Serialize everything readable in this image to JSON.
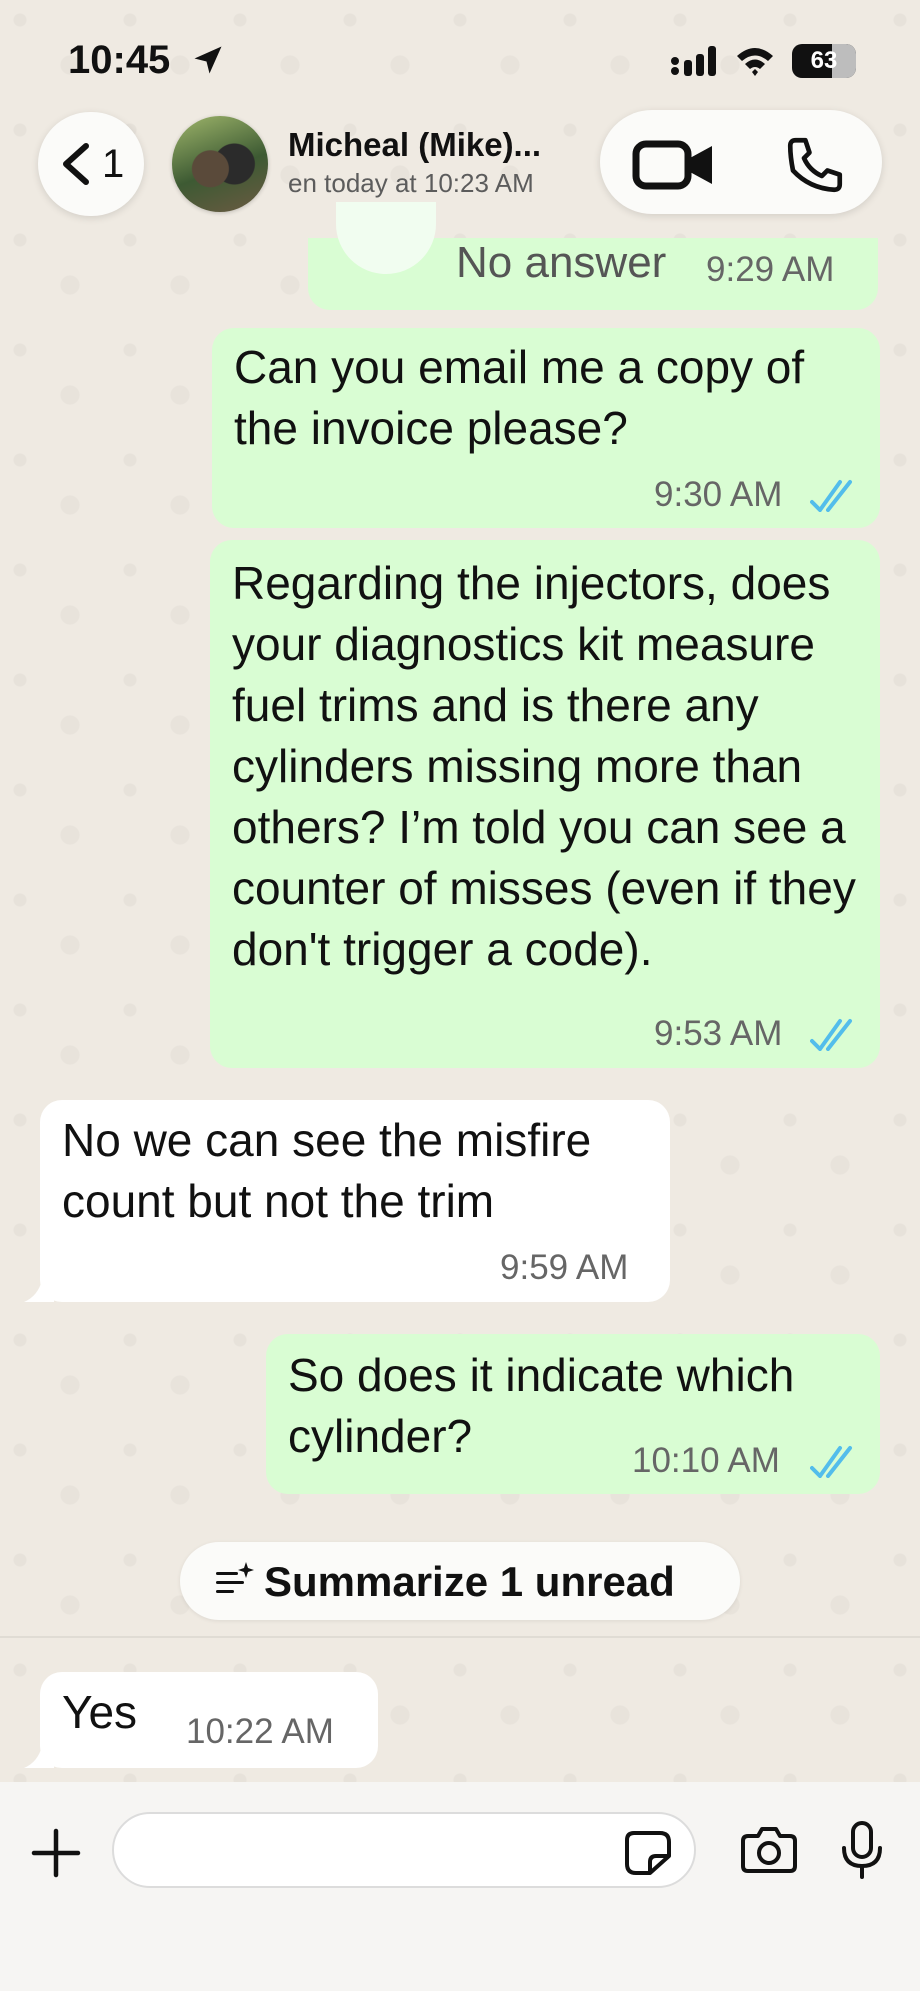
{
  "status_bar": {
    "time": "10:45",
    "battery_percent": "63",
    "battery_level": 0.63
  },
  "header": {
    "back_count": "1",
    "contact_name": "Micheal (Mike)...",
    "last_seen": "en today at 10:23 AM"
  },
  "messages": [
    {
      "direction": "outgoing",
      "text": "No answer",
      "time": "9:29 AM",
      "kind": "call"
    },
    {
      "direction": "outgoing",
      "text": "Can you email me a copy of the invoice please?",
      "time": "9:30 AM",
      "read": true
    },
    {
      "direction": "outgoing",
      "text": "Regarding the injectors, does your diagnostics kit measure fuel trims and is there any cylinders missing more than others? I’m told you can see a counter of misses (even if they don't trigger a code).",
      "time": "9:53 AM",
      "read": true
    },
    {
      "direction": "incoming",
      "text": "No we can see the misfire count but not the trim",
      "time": "9:59 AM"
    },
    {
      "direction": "outgoing",
      "text": "So does it indicate which cylinder?",
      "time": "10:10 AM",
      "read": true
    },
    {
      "direction": "incoming",
      "text": "Yes",
      "time": "10:22 AM"
    }
  ],
  "summarize_label": "Summarize 1 unread",
  "composer": {
    "placeholder": "",
    "value": ""
  },
  "colors": {
    "outgoing": "#d9fdd3",
    "incoming": "#ffffff",
    "read_ticks": "#53bdeb",
    "wallpaper": "#efeae2"
  }
}
